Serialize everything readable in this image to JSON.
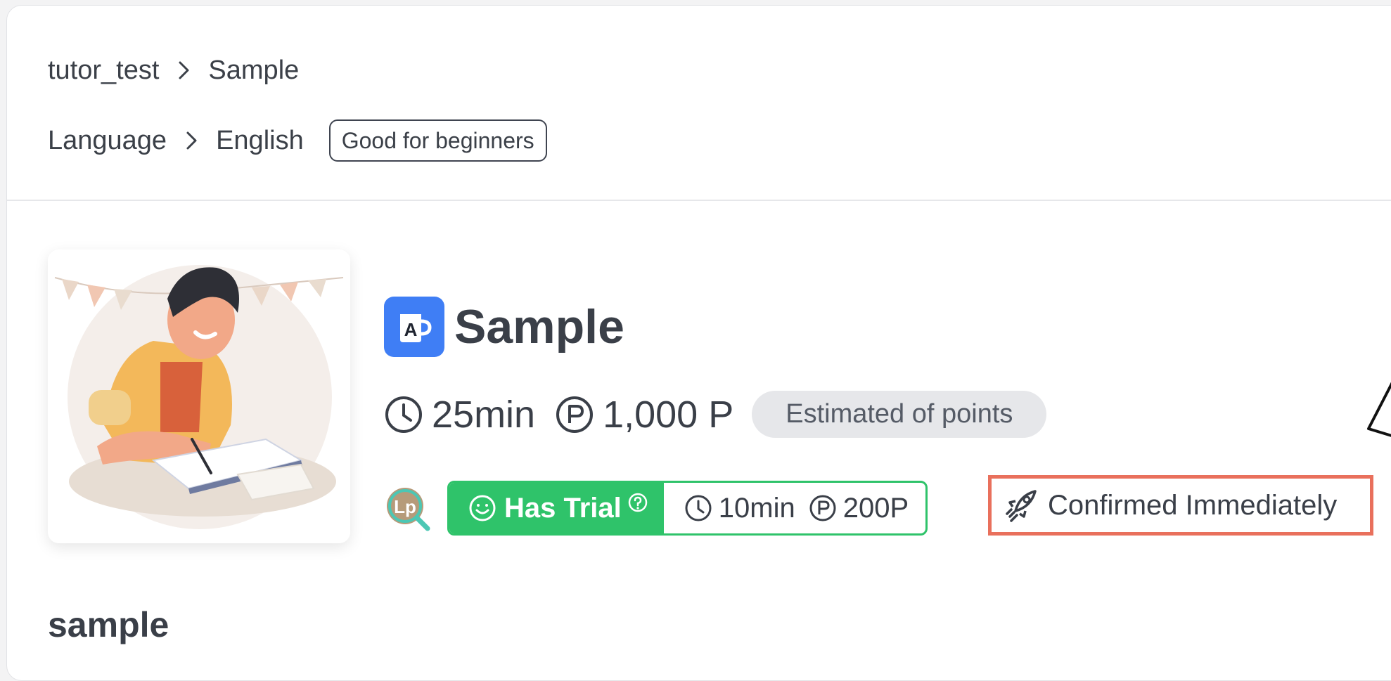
{
  "breadcrumb": {
    "first": "tutor_test",
    "second": "Sample"
  },
  "category": {
    "parent": "Language",
    "child": "English",
    "tag": "Good for beginners"
  },
  "lesson": {
    "title": "Sample",
    "duration": "25min",
    "points": "1,000 P",
    "estimate_label": "Estimated of points"
  },
  "trial": {
    "label": "Has Trial",
    "duration": "10min",
    "points": "200P"
  },
  "confirmation": {
    "label": "Confirmed Immediately"
  },
  "description_heading": "sample",
  "colors": {
    "accent_blue": "#3f7ef5",
    "trial_green": "#2fc36a",
    "highlight_red": "#e9705c"
  },
  "icons": [
    "chevron-right-icon",
    "app-cup-icon",
    "clock-icon",
    "points-icon",
    "lp-search-icon",
    "smile-icon",
    "question-icon",
    "rocket-icon"
  ]
}
